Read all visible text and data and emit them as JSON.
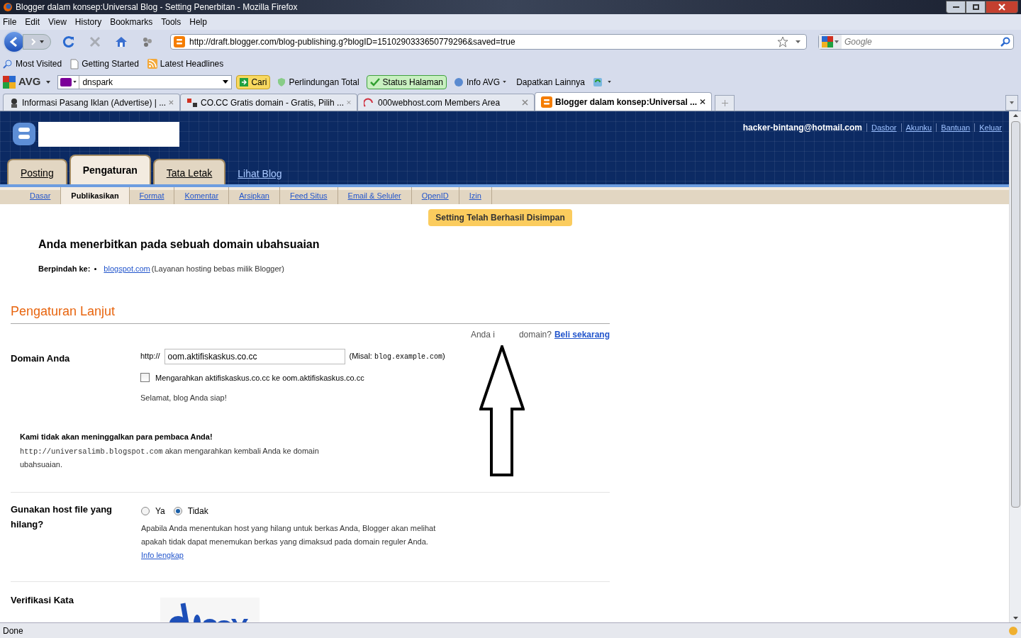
{
  "window": {
    "title": "Blogger dalam konsep:Universal Blog - Setting Penerbitan - Mozilla Firefox"
  },
  "menu": [
    "File",
    "Edit",
    "View",
    "History",
    "Bookmarks",
    "Tools",
    "Help"
  ],
  "nav": {
    "url": "http://draft.blogger.com/blog-publishing.g?blogID=1510290333650779296&saved=true",
    "search_placeholder": "Google"
  },
  "bookmarks": [
    "Most Visited",
    "Getting Started",
    "Latest Headlines"
  ],
  "avg_toolbar": {
    "logo": "AVG",
    "search_value": "dnspark",
    "search_button": "Cari",
    "items": [
      "Perlindungan Total",
      "Status Halaman",
      "Info AVG",
      "Dapatkan Lainnya"
    ]
  },
  "browser_tabs": [
    {
      "title": "Informasi Pasang Iklan (Advertise) | ...",
      "selected": false
    },
    {
      "title": "CO.CC Gratis domain - Gratis, Pilih ...",
      "selected": false
    },
    {
      "title": "000webhost.com Members Area",
      "selected": false
    },
    {
      "title": "Blogger dalam konsep:Universal ...",
      "selected": true
    }
  ],
  "header": {
    "user": "hacker-bintang@hotmail.com",
    "links": [
      "Dasbor",
      "Akunku",
      "Bantuan",
      "Keluar"
    ]
  },
  "main_tabs": [
    {
      "label": "Posting",
      "kind": "tab",
      "selected": false
    },
    {
      "label": "Pengaturan",
      "kind": "tab",
      "selected": true
    },
    {
      "label": "Tata Letak",
      "kind": "tab",
      "selected": false
    },
    {
      "label": "Lihat Blog",
      "kind": "link",
      "selected": false
    }
  ],
  "sub_tabs": [
    {
      "label": "Dasar",
      "selected": false
    },
    {
      "label": "Publikasikan",
      "selected": true
    },
    {
      "label": "Format",
      "selected": false
    },
    {
      "label": "Komentar",
      "selected": false
    },
    {
      "label": "Arsipkan",
      "selected": false
    },
    {
      "label": "Feed Situs",
      "selected": false
    },
    {
      "label": "Email & Seluler",
      "selected": false
    },
    {
      "label": "OpenID",
      "selected": false
    },
    {
      "label": "Izin",
      "selected": false
    }
  ],
  "notice": "Setting Telah Berhasil Disimpan",
  "publish": {
    "heading": "Anda menerbitkan pada sebuah domain ubahsuaian",
    "switch_label": "Berpindah ke:",
    "switch_link": "blogspot.com",
    "switch_note": "(Layanan hosting bebas milik Blogger)"
  },
  "advanced": {
    "heading": "Pengaturan Lanjut",
    "buy_prefix": "Anda i",
    "buy_suffix": "domain?",
    "buy_link": "Beli sekarang",
    "domain_label": "Domain Anda",
    "domain_prefix": "http://",
    "domain_value": "oom.aktifiskaskus.co.cc",
    "domain_example_prefix": "(Misal:",
    "domain_example": "blog.example.com",
    "domain_example_suffix": ")",
    "redirect": {
      "label": "Mengarahkan aktifiskaskus.co.cc ke oom.aktifiskaskus.co.cc",
      "checked": false
    },
    "ready": "Selamat, blog Anda siap!",
    "readers_heading": "Kami tidak akan meninggalkan para pembaca Anda!",
    "readers_url": "http://universalimb.blogspot.com",
    "readers_text": "akan mengarahkan kembali Anda ke domain ubahsuaian.",
    "missing_label": "Gunakan host file yang hilang?",
    "missing_options": [
      {
        "label": "Ya",
        "selected": false
      },
      {
        "label": "Tidak",
        "selected": true
      }
    ],
    "missing_help": "Apabila Anda menentukan host yang hilang untuk berkas Anda, Blogger akan melihat apakah tidak dapat menemukan berkas yang dimaksud pada domain reguler Anda.",
    "missing_link": "Info lengkap",
    "verify_label": "Verifikasi Kata"
  },
  "status_bar": "Done"
}
